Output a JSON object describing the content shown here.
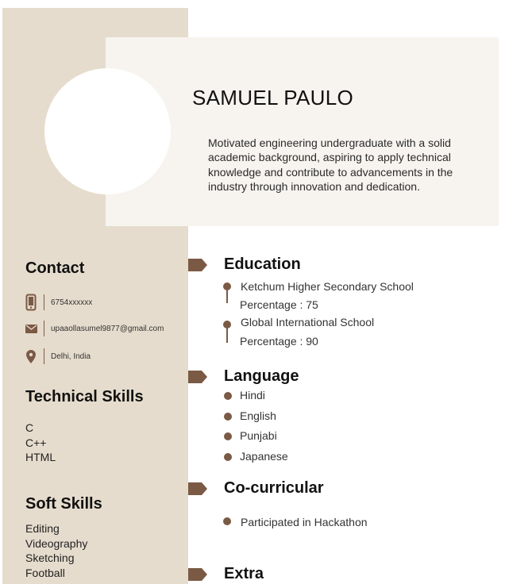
{
  "header": {
    "name": "SAMUEL PAULO",
    "summary": "Motivated engineering undergraduate with a solid academic background, aspiring to apply technical knowledge and contribute to advancements in the industry through innovation and dedication."
  },
  "contact": {
    "title": "Contact",
    "phone": "6754xxxxxx",
    "email": "upaaollasumel9877@gmail.com",
    "location": "Delhi, India"
  },
  "technical_skills": {
    "title": "Technical Skills",
    "items": [
      "C",
      "C++",
      "HTML"
    ]
  },
  "soft_skills": {
    "title": "Soft Skills",
    "items": [
      "Editing",
      "Videography",
      "Sketching",
      "Football"
    ]
  },
  "education": {
    "title": "Education",
    "entries": [
      {
        "school": "Ketchum Higher Secondary School",
        "score": "Percentage : 75"
      },
      {
        "school": "Global International  School",
        "score": "Percentage : 90"
      }
    ]
  },
  "language": {
    "title": "Language",
    "items": [
      "Hindi",
      "English",
      "Punjabi",
      "Japanese"
    ]
  },
  "cocurricular": {
    "title": "Co-curricular",
    "items": [
      "Participated in Hackathon"
    ]
  },
  "extra": {
    "title": "Extra"
  },
  "colors": {
    "sidebar": "#e6dccd",
    "header_band": "#f7f4ef",
    "accent": "#7a5a45"
  },
  "icons": [
    "phone-icon",
    "email-icon",
    "location-pin-icon"
  ]
}
